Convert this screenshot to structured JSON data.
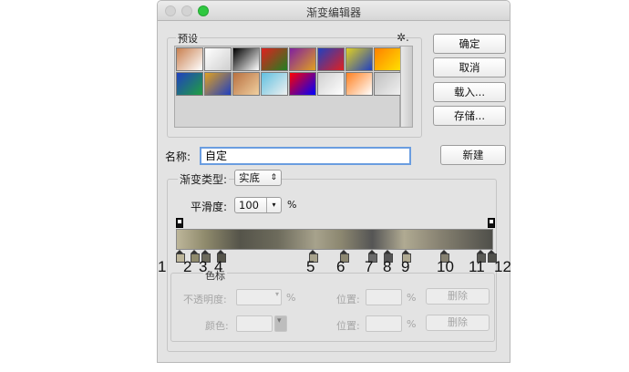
{
  "window": {
    "title": "渐变编辑器"
  },
  "presets": {
    "legend": "预设",
    "swatches": [
      [
        "#c98050",
        "#ffffff"
      ],
      [
        "#ffffff",
        "#cfcfcf"
      ],
      [
        "#000000",
        "#ffffff"
      ],
      [
        "#e02020",
        "#208020"
      ],
      [
        "#8020a0",
        "#e0a020"
      ],
      [
        "#2040c0",
        "#e02020"
      ],
      [
        "#e0d020",
        "#2040c0"
      ],
      [
        "#ff8000",
        "#ffe000"
      ],
      [
        "#2040c0",
        "#20a040"
      ],
      [
        "#e0a020",
        "#2040c0"
      ],
      [
        "#b87040",
        "#f0d0a0"
      ],
      [
        "#60c0e0",
        "#f0f0f0"
      ],
      [
        "#ff0000",
        "#0000ff"
      ],
      [
        "#d0d0d0",
        "#ffffff"
      ],
      [
        "#ff8020",
        "#ffffff"
      ],
      [
        "#c0c0c0",
        "#f0f0f0"
      ]
    ]
  },
  "buttons": {
    "ok": "确定",
    "cancel": "取消",
    "load": "载入...",
    "save": "存储...",
    "new": "新建"
  },
  "name": {
    "label": "名称:",
    "value": "自定"
  },
  "gradient_type": {
    "label": "渐变类型:",
    "value": "实底"
  },
  "smoothness": {
    "label": "平滑度:",
    "value": "100",
    "unit": "%"
  },
  "stop_numbers": [
    "1",
    "2",
    "3",
    "4",
    "5",
    "6",
    "7",
    "8",
    "9",
    "10",
    "11",
    "12"
  ],
  "stops_panel": {
    "legend": "色标",
    "opacity_label": "不透明度:",
    "opacity_unit": "%",
    "color_label": "颜色:",
    "location_label": "位置:",
    "location_unit": "%",
    "delete_label": "删除"
  }
}
